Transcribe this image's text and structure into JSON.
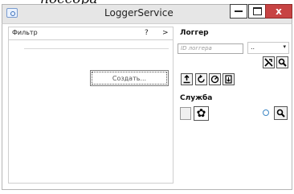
{
  "clipped_caption": "поссора",
  "window": {
    "title": "LoggerService",
    "close_label": "x"
  },
  "filter": {
    "label": "Фильтр",
    "help_label": "?",
    "expand_label": ">"
  },
  "left_pane": {
    "create_button": "Создать..."
  },
  "logger": {
    "header": "Логгер",
    "id_placeholder": "ID логгера",
    "type_value": "..",
    "type_caret": "▾"
  },
  "service": {
    "header": "Служба",
    "gear_glyph": "✿"
  },
  "icons": [
    "app-icon",
    "minimize-icon",
    "maximize-icon",
    "close-icon",
    "connect-icon",
    "search-icon",
    "upload-icon",
    "refresh-icon",
    "gauge-icon",
    "export-icon",
    "settings-icon",
    "status-indicator-icon"
  ],
  "colors": {
    "close_red": "#c74343",
    "accent_blue": "#3f88c5"
  }
}
